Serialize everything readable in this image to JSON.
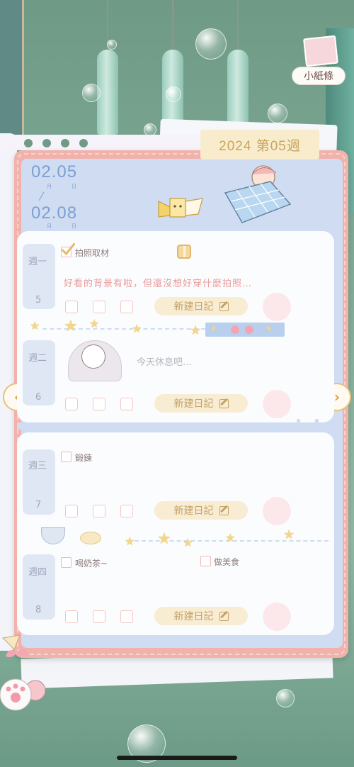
{
  "header": {
    "week_label": "2024 第05週",
    "memo_label": "小紙條"
  },
  "date_range": {
    "start": "02.05",
    "end": "02.08",
    "month_small": "月",
    "day_small": "日"
  },
  "days": [
    {
      "weekday": "週一",
      "day": "5",
      "tasks": [
        {
          "label": "拍照取材",
          "checked": true
        }
      ],
      "note": "好看的背景有啦，但還沒想好穿什麼拍照…",
      "new_entry": "新建日記"
    },
    {
      "weekday": "週二",
      "day": "6",
      "tasks": [],
      "note": "今天休息吧…",
      "new_entry": "新建日記"
    },
    {
      "weekday": "週三",
      "day": "7",
      "tasks": [
        {
          "label": "鍛鍊",
          "checked": false
        }
      ],
      "note": "",
      "new_entry": "新建日記"
    },
    {
      "weekday": "週四",
      "day": "8",
      "tasks": [
        {
          "label": "喝奶茶~",
          "checked": false
        },
        {
          "label": "做美食",
          "checked": false
        }
      ],
      "note": "",
      "new_entry": "新建日記"
    }
  ],
  "nav": {
    "prev": "‹",
    "next": "›"
  },
  "colors": {
    "background": "#7faa95",
    "notebook_border": "#f1b2ac",
    "page_blue": "#cfdcf2",
    "accent_gold": "#c4a368",
    "note_pink": "#ea9a9a",
    "date_blue": "#7e9fd3"
  },
  "icons": [
    "gift-icon",
    "pen-icon",
    "star-icon",
    "checkmark-icon",
    "chevron-left-icon",
    "chevron-right-icon"
  ]
}
